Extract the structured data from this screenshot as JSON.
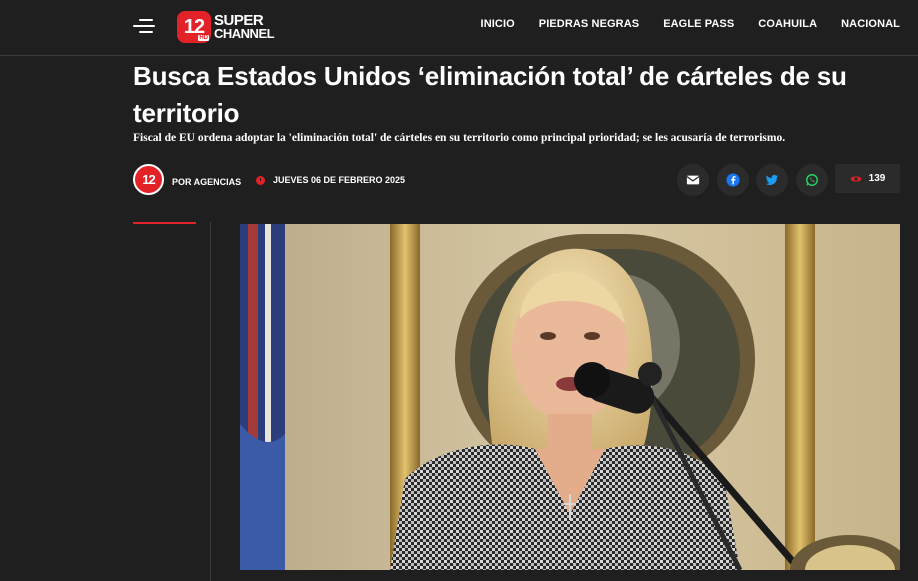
{
  "header": {
    "logo_number": "12",
    "logo_sub": "HD",
    "logo_line1": "SUPER",
    "logo_line2": "CHANNEL",
    "nav": [
      "INICIO",
      "PIEDRAS NEGRAS",
      "EAGLE PASS",
      "COAHUILA",
      "NACIONAL"
    ]
  },
  "article": {
    "title": "Busca Estados Unidos ‘eliminación total’ de cárteles de su territorio",
    "subtitle": "Fiscal de EU ordena adoptar la 'eliminación total' de cárteles en su territorio como principal prioridad; se les acusaría de terrorismo.",
    "author": "POR AGENCIAS",
    "date": "JUEVES 06 DE FEBRERO 2025",
    "views": "139"
  },
  "icons": {
    "menu": "hamburger-icon",
    "clock": "clock-icon",
    "email": "envelope-icon",
    "facebook": "facebook-icon",
    "twitter": "twitter-icon",
    "whatsapp": "whatsapp-icon",
    "views": "eye-icon"
  },
  "colors": {
    "background": "#1f1f1f",
    "accent": "#e32228",
    "facebook": "#1877f2",
    "twitter": "#1d9bf0",
    "whatsapp": "#25d366"
  }
}
